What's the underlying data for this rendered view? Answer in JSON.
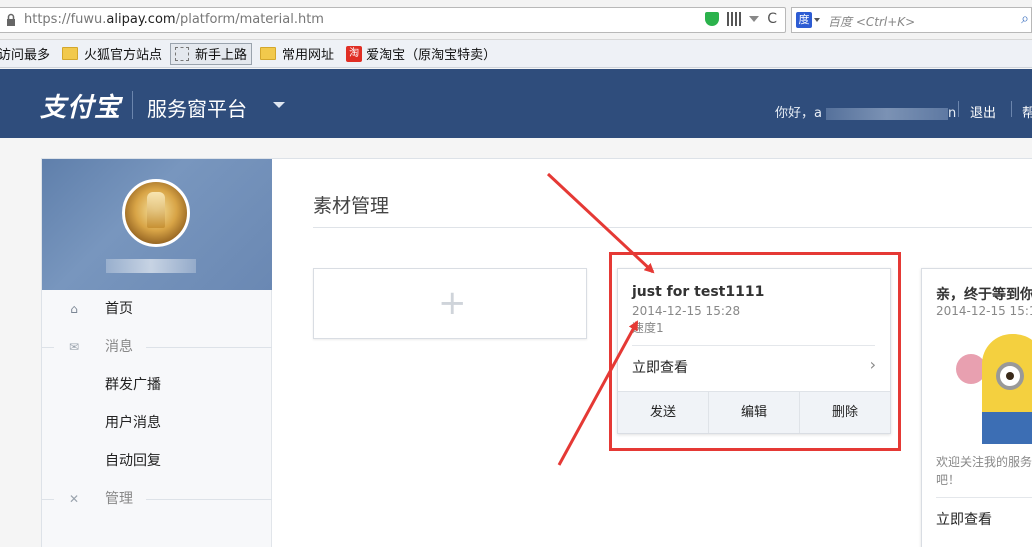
{
  "browser": {
    "url_prefix": "https://fuwu.",
    "url_domain": "alipay.com",
    "url_path": "/platform/material.htm",
    "search_placeholder": "百度 <Ctrl+K>",
    "reload_glyph": "C"
  },
  "bookmarks": [
    {
      "label": "访问最多",
      "icon": "folder-icon"
    },
    {
      "label": "火狐官方站点",
      "icon": "folder-icon"
    },
    {
      "label": "新手上路",
      "icon": "page-icon"
    },
    {
      "label": "常用网址",
      "icon": "folder-icon"
    },
    {
      "label": "爱淘宝（原淘宝特卖）",
      "icon": "taobao-icon"
    }
  ],
  "header": {
    "logo": "支付宝",
    "platform": "服务窗平台",
    "greeting": "你好，a",
    "greeting_suffix": "n",
    "logout": "退出",
    "help": "帮"
  },
  "sidebar": {
    "items": [
      {
        "label": "首页",
        "icon": "home-icon",
        "kind": "item"
      },
      {
        "label": "消息",
        "icon": "mail-icon",
        "kind": "section"
      },
      {
        "label": "群发广播",
        "kind": "sub"
      },
      {
        "label": "用户消息",
        "kind": "sub"
      },
      {
        "label": "自动回复",
        "kind": "sub"
      },
      {
        "label": "管理",
        "icon": "wrench-icon",
        "kind": "section"
      }
    ]
  },
  "main": {
    "title": "素材管理",
    "add_symbol": "+",
    "card1": {
      "title": "just for test1111",
      "date": "2014-12-15 15:28",
      "desc": "速度1",
      "view": "立即查看",
      "chevron": "›",
      "actions": [
        "发送",
        "编辑",
        "删除"
      ]
    },
    "card2": {
      "title": "亲，终于等到你",
      "date": "2014-12-15 15:1",
      "desc_line1": "欢迎关注我的服务",
      "desc_line2": "吧！",
      "view": "立即查看"
    }
  },
  "colors": {
    "header_bg": "#2f4d7c",
    "highlight": "#e53935",
    "arrow": "#e53935"
  }
}
